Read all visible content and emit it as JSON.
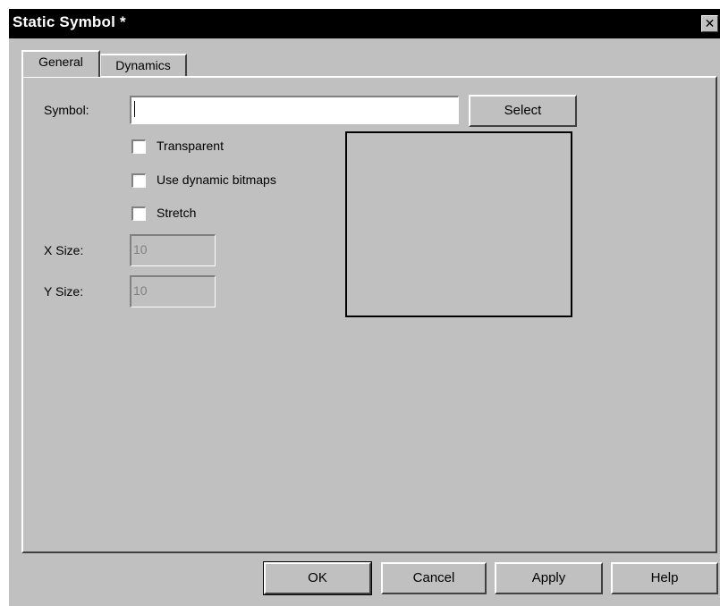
{
  "window": {
    "title": "Static Symbol *"
  },
  "tabs": [
    {
      "label": "General"
    },
    {
      "label": "Dynamics"
    }
  ],
  "fields": {
    "symbol_label": "Symbol:",
    "symbol_value": "",
    "select_label": "Select",
    "transparent_label": "Transparent",
    "use_dynamic_bitmaps_label": "Use dynamic bitmaps",
    "stretch_label": "Stretch",
    "x_size_label": "X Size:",
    "x_size_value": "10",
    "y_size_label": "Y Size:",
    "y_size_value": "10"
  },
  "buttons": {
    "ok": "OK",
    "cancel": "Cancel",
    "apply": "Apply",
    "help": "Help"
  },
  "icons": {
    "close": "close-icon"
  },
  "colors": {
    "titlebar": "#000000",
    "face": "#c0c0c0"
  }
}
